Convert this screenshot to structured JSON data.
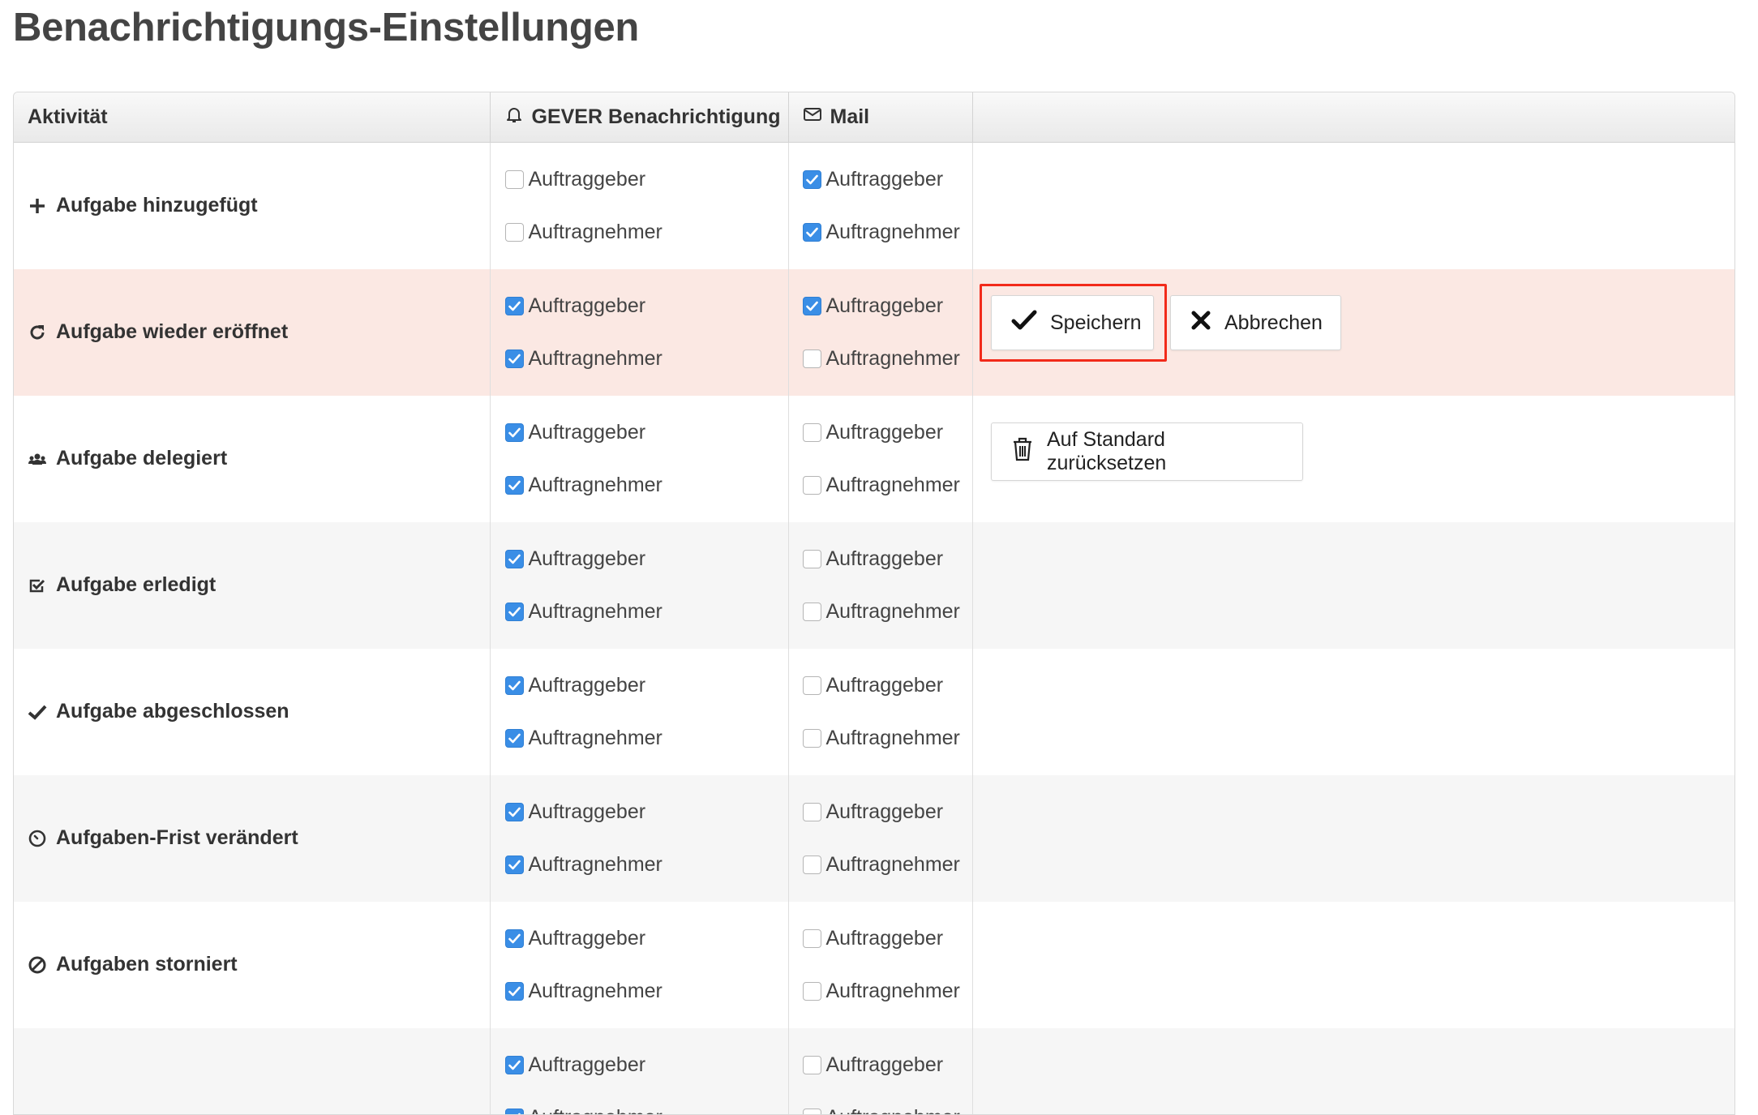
{
  "page": {
    "title": "Benachrichtigungs-Einstellungen"
  },
  "table": {
    "headers": {
      "activity": "Aktivität",
      "gever": "GEVER Benachrichtigung",
      "mail": "Mail"
    },
    "option_labels": {
      "giver": "Auftraggeber",
      "taker": "Auftragnehmer"
    },
    "rows": [
      {
        "icon": "plus-icon",
        "label": "Aufgabe hinzugefügt",
        "gever": {
          "giver": false,
          "taker": false
        },
        "mail": {
          "giver": true,
          "taker": true
        }
      },
      {
        "icon": "refresh-icon",
        "label": "Aufgabe wieder eröffnet",
        "active": true,
        "gever": {
          "giver": true,
          "taker": true
        },
        "mail": {
          "giver": true,
          "taker": false
        }
      },
      {
        "icon": "users-icon",
        "label": "Aufgabe delegiert",
        "gever": {
          "giver": true,
          "taker": true
        },
        "mail": {
          "giver": false,
          "taker": false
        }
      },
      {
        "icon": "check-square-icon",
        "label": "Aufgabe erledigt",
        "gever": {
          "giver": true,
          "taker": true
        },
        "mail": {
          "giver": false,
          "taker": false
        }
      },
      {
        "icon": "checkmark-icon",
        "label": "Aufgabe abgeschlossen",
        "gever": {
          "giver": true,
          "taker": true
        },
        "mail": {
          "giver": false,
          "taker": false
        }
      },
      {
        "icon": "clock-icon",
        "label": "Aufgaben-Frist verändert",
        "gever": {
          "giver": true,
          "taker": true
        },
        "mail": {
          "giver": false,
          "taker": false
        }
      },
      {
        "icon": "ban-icon",
        "label": "Aufgaben storniert",
        "gever": {
          "giver": true,
          "taker": true
        },
        "mail": {
          "giver": false,
          "taker": false
        }
      },
      {
        "icon": "",
        "label": "",
        "gever": {
          "giver": true,
          "taker": true
        },
        "mail": {
          "giver": false,
          "taker": false
        }
      }
    ]
  },
  "actions": {
    "save_label": "Speichern",
    "cancel_label": "Abbrechen",
    "reset_label": "Auf Standard zurücksetzen"
  },
  "colors": {
    "checkbox_checked": "#3a8ee6",
    "active_row": "#fbe8e3",
    "highlight_frame": "#f22a1a"
  }
}
